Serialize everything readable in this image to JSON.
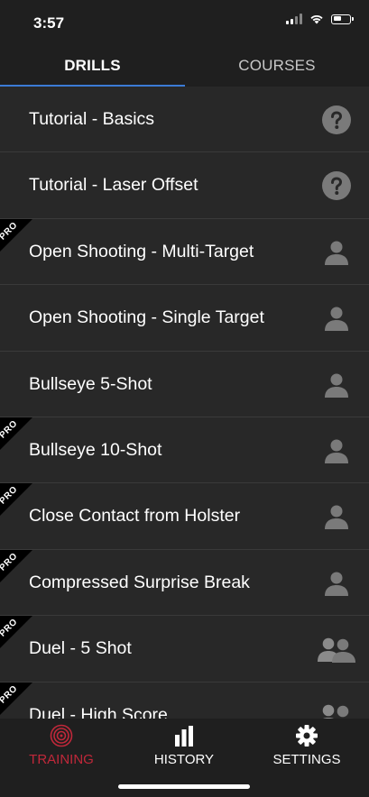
{
  "status_bar": {
    "time": "3:57"
  },
  "tabs": [
    {
      "label": "DRILLS",
      "selected": true
    },
    {
      "label": "COURSES",
      "selected": false
    }
  ],
  "drills": [
    {
      "label": "Tutorial - Basics",
      "pro": false,
      "icon": "question-icon"
    },
    {
      "label": "Tutorial - Laser Offset",
      "pro": false,
      "icon": "question-icon"
    },
    {
      "label": "Open Shooting - Multi-Target",
      "pro": true,
      "icon": "single-user-icon"
    },
    {
      "label": "Open Shooting - Single Target",
      "pro": false,
      "icon": "single-user-icon"
    },
    {
      "label": "Bullseye 5-Shot",
      "pro": false,
      "icon": "single-user-icon"
    },
    {
      "label": "Bullseye 10-Shot",
      "pro": true,
      "icon": "single-user-icon"
    },
    {
      "label": "Close Contact from Holster",
      "pro": true,
      "icon": "single-user-icon"
    },
    {
      "label": "Compressed Surprise Break",
      "pro": true,
      "icon": "single-user-icon"
    },
    {
      "label": "Duel - 5 Shot",
      "pro": true,
      "icon": "two-users-icon"
    },
    {
      "label": "Duel - High Score",
      "pro": true,
      "icon": "two-users-icon"
    }
  ],
  "pro_badge": "PRO",
  "bottom_nav": [
    {
      "label": "TRAINING",
      "icon": "target-icon",
      "active": true
    },
    {
      "label": "HISTORY",
      "icon": "bar-chart-icon",
      "active": false
    },
    {
      "label": "SETTINGS",
      "icon": "gear-icon",
      "active": false
    }
  ],
  "colors": {
    "background": "#282828",
    "bar_background": "#1f1f1f",
    "accent_blue": "#3b7bd6",
    "active_red": "#c0283a",
    "icon_gray": "#7a7a7a"
  }
}
